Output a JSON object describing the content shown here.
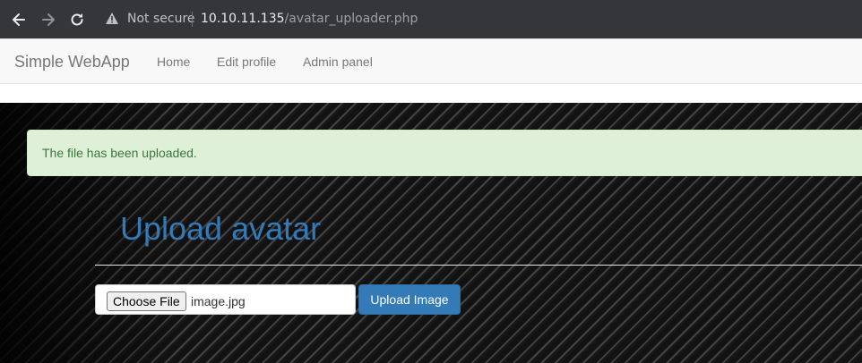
{
  "browser": {
    "security_label": "Not secure",
    "url_host": "10.10.11.135",
    "url_path": "/avatar_uploader.php"
  },
  "navbar": {
    "brand": "Simple WebApp",
    "links": [
      "Home",
      "Edit profile",
      "Admin panel"
    ]
  },
  "alert": {
    "message": "The file has been uploaded.",
    "color": "#dff0d8"
  },
  "form": {
    "title": "Upload avatar",
    "choose_label": "Choose File",
    "file_name": "image.jpg",
    "submit_label": "Upload Image"
  },
  "colors": {
    "accent": "#337ab7",
    "success_text": "#3c763d"
  },
  "icons": {
    "back": "arrow-left-icon",
    "forward": "arrow-right-icon",
    "reload": "reload-icon",
    "security": "warning-icon"
  }
}
